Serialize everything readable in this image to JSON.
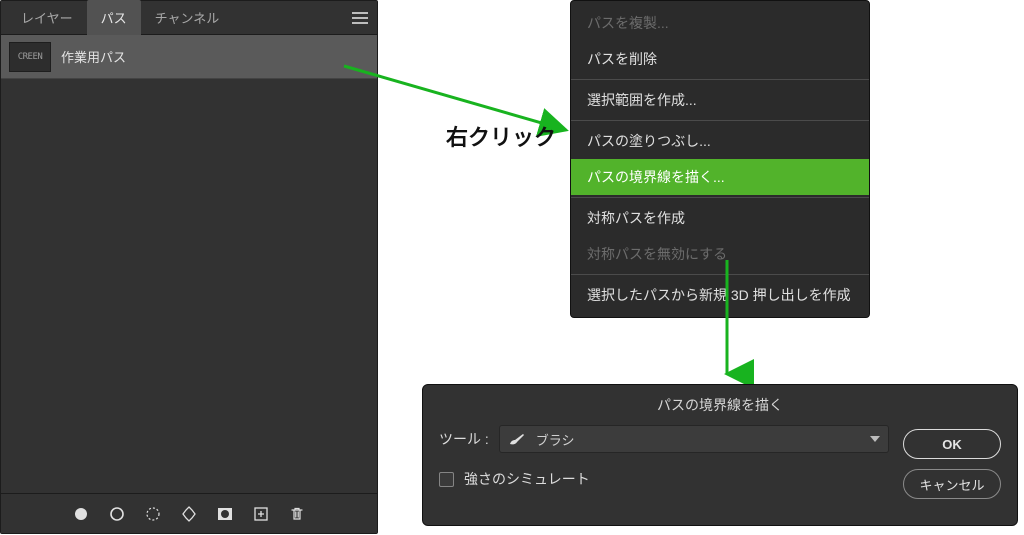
{
  "colors": {
    "highlight": "#52b32b",
    "arrow": "#18b31f"
  },
  "panel": {
    "tabs": [
      "レイヤー",
      "パス",
      "チャンネル"
    ],
    "activeTabIndex": 1,
    "item": {
      "thumbText": "CREEN",
      "label": "作業用パス"
    },
    "footerIcons": [
      "fill-circle",
      "stroke-circle",
      "selection-from-path",
      "path-from-selection",
      "add-mask",
      "new-path",
      "trash"
    ]
  },
  "rightClickLabel": "右クリック",
  "contextMenu": {
    "items": [
      {
        "label": "パスを複製...",
        "disabled": true
      },
      {
        "label": "パスを削除"
      },
      {
        "sep": true
      },
      {
        "label": "選択範囲を作成..."
      },
      {
        "sep": true
      },
      {
        "label": "パスの塗りつぶし..."
      },
      {
        "label": "パスの境界線を描く...",
        "highlight": true
      },
      {
        "sep": true
      },
      {
        "label": "対称パスを作成"
      },
      {
        "label": "対称パスを無効にする",
        "disabled": true
      },
      {
        "sep": true
      },
      {
        "label": "選択したパスから新規 3D 押し出しを作成"
      }
    ]
  },
  "dialog": {
    "title": "パスの境界線を描く",
    "toolLabel": "ツール :",
    "toolSelected": "ブラシ",
    "simulateLabel": "強さのシミュレート",
    "ok": "OK",
    "cancel": "キャンセル"
  }
}
